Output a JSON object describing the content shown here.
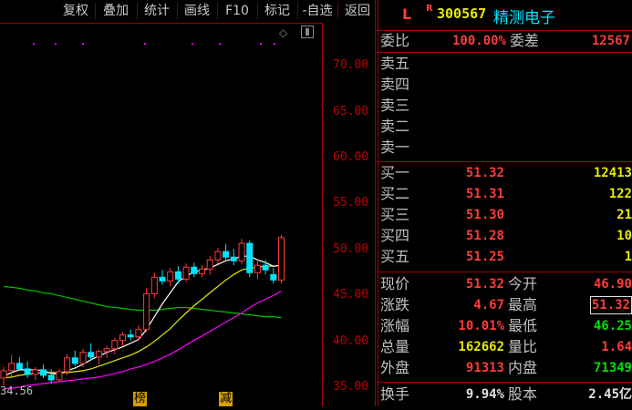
{
  "toolbar": {
    "items": [
      "复权",
      "叠加",
      "统计",
      "画线",
      "F10",
      "标记",
      "-自选",
      "返回"
    ]
  },
  "chart": {
    "y_ticks": [
      "70.00",
      "65.00",
      "60.00",
      "55.00",
      "50.00",
      "45.00",
      "40.00",
      "35.00"
    ],
    "low_label": "34.56",
    "markers": [
      "榜",
      "减"
    ],
    "colors": {
      "up": "#ff3b3b",
      "down": "#00e5ff",
      "ma5": "#ffffff",
      "ma10": "#e8e800",
      "ma20": "#ff00ff",
      "ma60": "#00c000"
    }
  },
  "chart_data": {
    "type": "candlestick",
    "y_range": [
      34,
      73
    ],
    "candles": [
      {
        "o": 36.0,
        "h": 37.2,
        "l": 35.2,
        "c": 36.8
      },
      {
        "o": 36.8,
        "h": 38.5,
        "l": 36.2,
        "c": 37.6
      },
      {
        "o": 37.6,
        "h": 38.3,
        "l": 36.8,
        "c": 37.0
      },
      {
        "o": 37.0,
        "h": 37.8,
        "l": 36.0,
        "c": 36.4
      },
      {
        "o": 36.4,
        "h": 37.2,
        "l": 35.8,
        "c": 36.9
      },
      {
        "o": 36.9,
        "h": 37.5,
        "l": 36.0,
        "c": 36.3
      },
      {
        "o": 36.3,
        "h": 37.0,
        "l": 35.4,
        "c": 35.8
      },
      {
        "o": 35.8,
        "h": 37.0,
        "l": 35.6,
        "c": 36.7
      },
      {
        "o": 36.7,
        "h": 38.6,
        "l": 36.3,
        "c": 38.2
      },
      {
        "o": 38.2,
        "h": 39.0,
        "l": 37.3,
        "c": 37.6
      },
      {
        "o": 37.6,
        "h": 39.2,
        "l": 37.2,
        "c": 38.8
      },
      {
        "o": 38.8,
        "h": 39.8,
        "l": 37.9,
        "c": 38.3
      },
      {
        "o": 38.3,
        "h": 39.1,
        "l": 37.5,
        "c": 38.9
      },
      {
        "o": 38.9,
        "h": 39.5,
        "l": 38.2,
        "c": 39.2
      },
      {
        "o": 39.2,
        "h": 40.4,
        "l": 38.6,
        "c": 40.1
      },
      {
        "o": 40.1,
        "h": 41.0,
        "l": 39.5,
        "c": 40.7
      },
      {
        "o": 40.7,
        "h": 41.3,
        "l": 40.1,
        "c": 40.5
      },
      {
        "o": 40.5,
        "h": 41.8,
        "l": 40.1,
        "c": 41.3
      },
      {
        "o": 41.3,
        "h": 45.8,
        "l": 41.0,
        "c": 45.2
      },
      {
        "o": 45.2,
        "h": 47.5,
        "l": 44.7,
        "c": 47.0
      },
      {
        "o": 47.0,
        "h": 47.8,
        "l": 46.2,
        "c": 46.6
      },
      {
        "o": 46.6,
        "h": 48.0,
        "l": 46.0,
        "c": 47.6
      },
      {
        "o": 47.6,
        "h": 48.2,
        "l": 46.3,
        "c": 46.8
      },
      {
        "o": 46.8,
        "h": 48.5,
        "l": 46.5,
        "c": 48.1
      },
      {
        "o": 48.1,
        "h": 48.6,
        "l": 47.0,
        "c": 47.4
      },
      {
        "o": 47.4,
        "h": 48.3,
        "l": 47.0,
        "c": 47.9
      },
      {
        "o": 47.9,
        "h": 49.3,
        "l": 47.3,
        "c": 48.9
      },
      {
        "o": 48.9,
        "h": 50.2,
        "l": 48.5,
        "c": 49.8
      },
      {
        "o": 49.8,
        "h": 50.6,
        "l": 48.8,
        "c": 49.2
      },
      {
        "o": 49.2,
        "h": 50.1,
        "l": 48.3,
        "c": 48.8
      },
      {
        "o": 48.8,
        "h": 51.2,
        "l": 48.4,
        "c": 50.7
      },
      {
        "o": 50.7,
        "h": 51.0,
        "l": 47.0,
        "c": 47.5
      },
      {
        "o": 47.5,
        "h": 49.0,
        "l": 46.8,
        "c": 48.3
      },
      {
        "o": 48.3,
        "h": 48.9,
        "l": 47.3,
        "c": 47.8
      },
      {
        "o": 47.3,
        "h": 48.0,
        "l": 46.3,
        "c": 46.7
      },
      {
        "o": 46.7,
        "h": 51.6,
        "l": 46.3,
        "c": 51.32
      }
    ],
    "ma5": [
      36.2,
      36.6,
      36.9,
      36.9,
      36.9,
      36.8,
      36.5,
      36.4,
      36.8,
      37.1,
      37.5,
      38.0,
      38.4,
      38.8,
      39.1,
      39.4,
      39.8,
      40.2,
      41.3,
      42.7,
      44.1,
      45.3,
      46.5,
      47.1,
      47.6,
      47.8,
      48.0,
      48.4,
      48.8,
      49.0,
      49.3,
      49.3,
      48.9,
      48.6,
      48.2,
      48.3
    ],
    "ma10": [
      36.0,
      36.1,
      36.3,
      36.4,
      36.5,
      36.6,
      36.6,
      36.6,
      36.6,
      36.7,
      36.8,
      37.0,
      37.3,
      37.6,
      37.9,
      38.2,
      38.5,
      38.9,
      39.4,
      40.0,
      40.7,
      41.4,
      42.3,
      43.1,
      43.9,
      44.6,
      45.3,
      46.0,
      46.7,
      47.3,
      47.8,
      48.0,
      48.1,
      48.2,
      48.2,
      48.3
    ],
    "ma20": [
      34.8,
      34.9,
      35.0,
      35.2,
      35.3,
      35.4,
      35.5,
      35.6,
      35.7,
      35.8,
      35.9,
      36.0,
      36.1,
      36.3,
      36.5,
      36.7,
      37.0,
      37.2,
      37.5,
      37.8,
      38.2,
      38.6,
      39.1,
      39.6,
      40.1,
      40.6,
      41.1,
      41.6,
      42.1,
      42.6,
      43.1,
      43.7,
      44.2,
      44.6,
      45.0,
      45.5
    ],
    "ma60": [
      46.0,
      45.9,
      45.8,
      45.6,
      45.5,
      45.3,
      45.2,
      45.0,
      44.8,
      44.6,
      44.4,
      44.2,
      44.0,
      43.8,
      43.7,
      43.6,
      43.5,
      43.4,
      43.4,
      43.4,
      43.5,
      43.6,
      43.7,
      43.7,
      43.6,
      43.5,
      43.4,
      43.3,
      43.2,
      43.1,
      43.0,
      42.9,
      42.8,
      42.7,
      42.7,
      42.6
    ]
  },
  "stock": {
    "flag": "L",
    "badge": "R",
    "code": "300567",
    "name": "精测电子"
  },
  "order_ratio": {
    "label_ratio": "委比",
    "ratio": "100.00%",
    "label_diff": "委差",
    "diff": "12567"
  },
  "asks": [
    {
      "label": "卖五",
      "price": "",
      "vol": ""
    },
    {
      "label": "卖四",
      "price": "",
      "vol": ""
    },
    {
      "label": "卖三",
      "price": "",
      "vol": ""
    },
    {
      "label": "卖二",
      "price": "",
      "vol": ""
    },
    {
      "label": "卖一",
      "price": "",
      "vol": ""
    }
  ],
  "bids": [
    {
      "label": "买一",
      "price": "51.32",
      "vol": "12413"
    },
    {
      "label": "买二",
      "price": "51.31",
      "vol": "122"
    },
    {
      "label": "买三",
      "price": "51.30",
      "vol": "21"
    },
    {
      "label": "买四",
      "price": "51.28",
      "vol": "10"
    },
    {
      "label": "买五",
      "price": "51.25",
      "vol": "1"
    }
  ],
  "quote": [
    {
      "l1": "现价",
      "v1": "51.32",
      "c1": "red",
      "l2": "今开",
      "v2": "46.90",
      "c2": "red"
    },
    {
      "l1": "涨跌",
      "v1": "4.67",
      "c1": "red",
      "l2": "最高",
      "v2": "51.32",
      "c2": "red"
    },
    {
      "l1": "涨幅",
      "v1": "10.01%",
      "c1": "red",
      "l2": "最低",
      "v2": "46.25",
      "c2": "green"
    },
    {
      "l1": "总量",
      "v1": "162662",
      "c1": "yellow",
      "l2": "量比",
      "v2": "1.64",
      "c2": "red"
    },
    {
      "l1": "外盘",
      "v1": "91313",
      "c1": "red",
      "l2": "内盘",
      "v2": "71349",
      "c2": "green"
    },
    {
      "l1": "换手",
      "v1": "9.94%",
      "c1": "white",
      "l2": "股本",
      "v2": "2.45亿",
      "c2": "white"
    }
  ]
}
